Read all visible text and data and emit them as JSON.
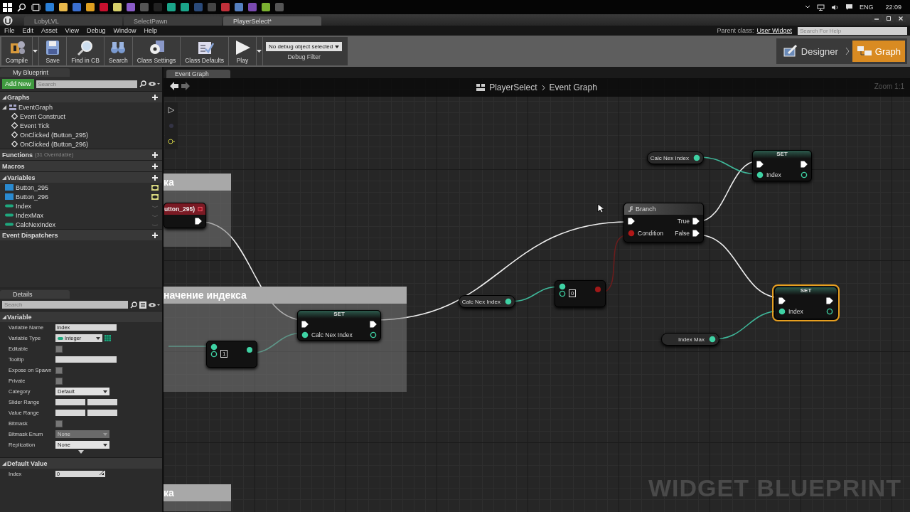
{
  "taskbar": {
    "language": "ENG",
    "time": "22:09"
  },
  "editor_tabs": [
    {
      "label": "LobyLVL",
      "selected": false
    },
    {
      "label": "SelectPawn",
      "selected": false
    },
    {
      "label": "PlayerSelect*",
      "selected": true
    }
  ],
  "menu": [
    "File",
    "Edit",
    "Asset",
    "View",
    "Debug",
    "Window",
    "Help"
  ],
  "parent_class": {
    "label": "Parent class:",
    "value": "User Widget"
  },
  "help_search": {
    "placeholder": "Search For Help"
  },
  "toolbar": [
    {
      "label": "Compile",
      "kind": "compile"
    },
    {
      "label": "Save",
      "kind": "save"
    },
    {
      "label": "Find in CB",
      "kind": "find"
    },
    {
      "label": "Search",
      "kind": "search"
    },
    {
      "label": "Class Settings",
      "kind": "settings"
    },
    {
      "label": "Class Defaults",
      "kind": "defaults"
    },
    {
      "label": "Play",
      "kind": "play"
    }
  ],
  "debug_filter": {
    "value": "No debug object selected",
    "label": "Debug Filter"
  },
  "modes": [
    {
      "label": "Designer",
      "selected": false
    },
    {
      "label": "Graph",
      "selected": true
    }
  ],
  "my_blueprint": {
    "title": "My Blueprint",
    "add_button": "Add New",
    "search": {
      "placeholder": "Search"
    },
    "sections": [
      {
        "title": "Graphs",
        "items": [
          {
            "label": "EventGraph",
            "kind": "graph",
            "children": [
              {
                "label": "Event Construct",
                "kind": "event"
              },
              {
                "label": "Event Tick",
                "kind": "event"
              },
              {
                "label": "OnClicked (Button_295)",
                "kind": "event"
              },
              {
                "label": "OnClicked (Button_296)",
                "kind": "event"
              }
            ]
          }
        ]
      },
      {
        "title": "Functions",
        "note": "(31 Overridable)"
      },
      {
        "title": "Macros"
      },
      {
        "title": "Variables",
        "items": [
          {
            "label": "Button_295",
            "kind": "widget",
            "public": true
          },
          {
            "label": "Button_296",
            "kind": "widget",
            "public": true
          },
          {
            "label": "Index",
            "kind": "integer",
            "public": false
          },
          {
            "label": "IndexMax",
            "kind": "integer",
            "public": false
          },
          {
            "label": "CalcNexIndex",
            "kind": "integer",
            "public": false
          }
        ]
      },
      {
        "title": "Event Dispatchers"
      }
    ]
  },
  "details": {
    "title": "Details",
    "search": {
      "placeholder": "Search"
    },
    "sections": [
      {
        "title": "Variable",
        "rows": [
          {
            "label": "Variable Name",
            "kind": "text",
            "value": "Index"
          },
          {
            "label": "Variable Type",
            "kind": "type",
            "value": "Integer"
          },
          {
            "label": "Editable",
            "kind": "checkbox",
            "checked": false
          },
          {
            "label": "Tooltip",
            "kind": "text"
          },
          {
            "label": "Expose on Spawn",
            "kind": "checkbox",
            "checked": false
          },
          {
            "label": "Private",
            "kind": "checkbox",
            "checked": false
          },
          {
            "label": "Category",
            "kind": "dropdown",
            "value": "Default",
            "disabled": false
          },
          {
            "label": "Slider Range",
            "kind": "range"
          },
          {
            "label": "Value Range",
            "kind": "range"
          },
          {
            "label": "Bitmask",
            "kind": "checkbox",
            "checked": false
          },
          {
            "label": "Bitmask Enum",
            "kind": "dropdown",
            "value": "None",
            "disabled": true
          },
          {
            "label": "Replication",
            "kind": "dropdown",
            "value": "None",
            "disabled": false
          }
        ]
      },
      {
        "title": "Default Value",
        "rows": [
          {
            "label": "Index",
            "kind": "number",
            "value": "0"
          }
        ]
      }
    ]
  },
  "graph": {
    "tab": "Event Graph",
    "breadcrumb": [
      "PlayerSelect",
      "Event Graph"
    ],
    "zoom": "Zoom 1:1",
    "watermark": "WIDGET BLUEPRINT",
    "nodes": [
      {
        "kind": "comment",
        "title": "ка"
      },
      {
        "kind": "event",
        "title": "utton_295)"
      },
      {
        "kind": "comment",
        "title": "начение индекса"
      },
      {
        "kind": "set",
        "title": "SET",
        "pin": "Calc Nex Index",
        "selected": false
      },
      {
        "kind": "math",
        "value": "1",
        "color": "#3fd2a4"
      },
      {
        "kind": "comment",
        "title": "ка"
      },
      {
        "kind": "getter",
        "label": "Calc Nex Index"
      },
      {
        "kind": "math",
        "value": "0",
        "color": "#a01818"
      },
      {
        "kind": "getter",
        "label": "Calc Nex Index"
      },
      {
        "kind": "set",
        "title": "SET",
        "pin": "Index",
        "selected": false
      },
      {
        "kind": "branch",
        "title": "Branch",
        "input": "Condition",
        "outputs": [
          "True",
          "False"
        ]
      },
      {
        "kind": "set",
        "title": "SET",
        "pin": "Index",
        "selected": true
      },
      {
        "kind": "getter",
        "label": "Index Max"
      }
    ]
  }
}
